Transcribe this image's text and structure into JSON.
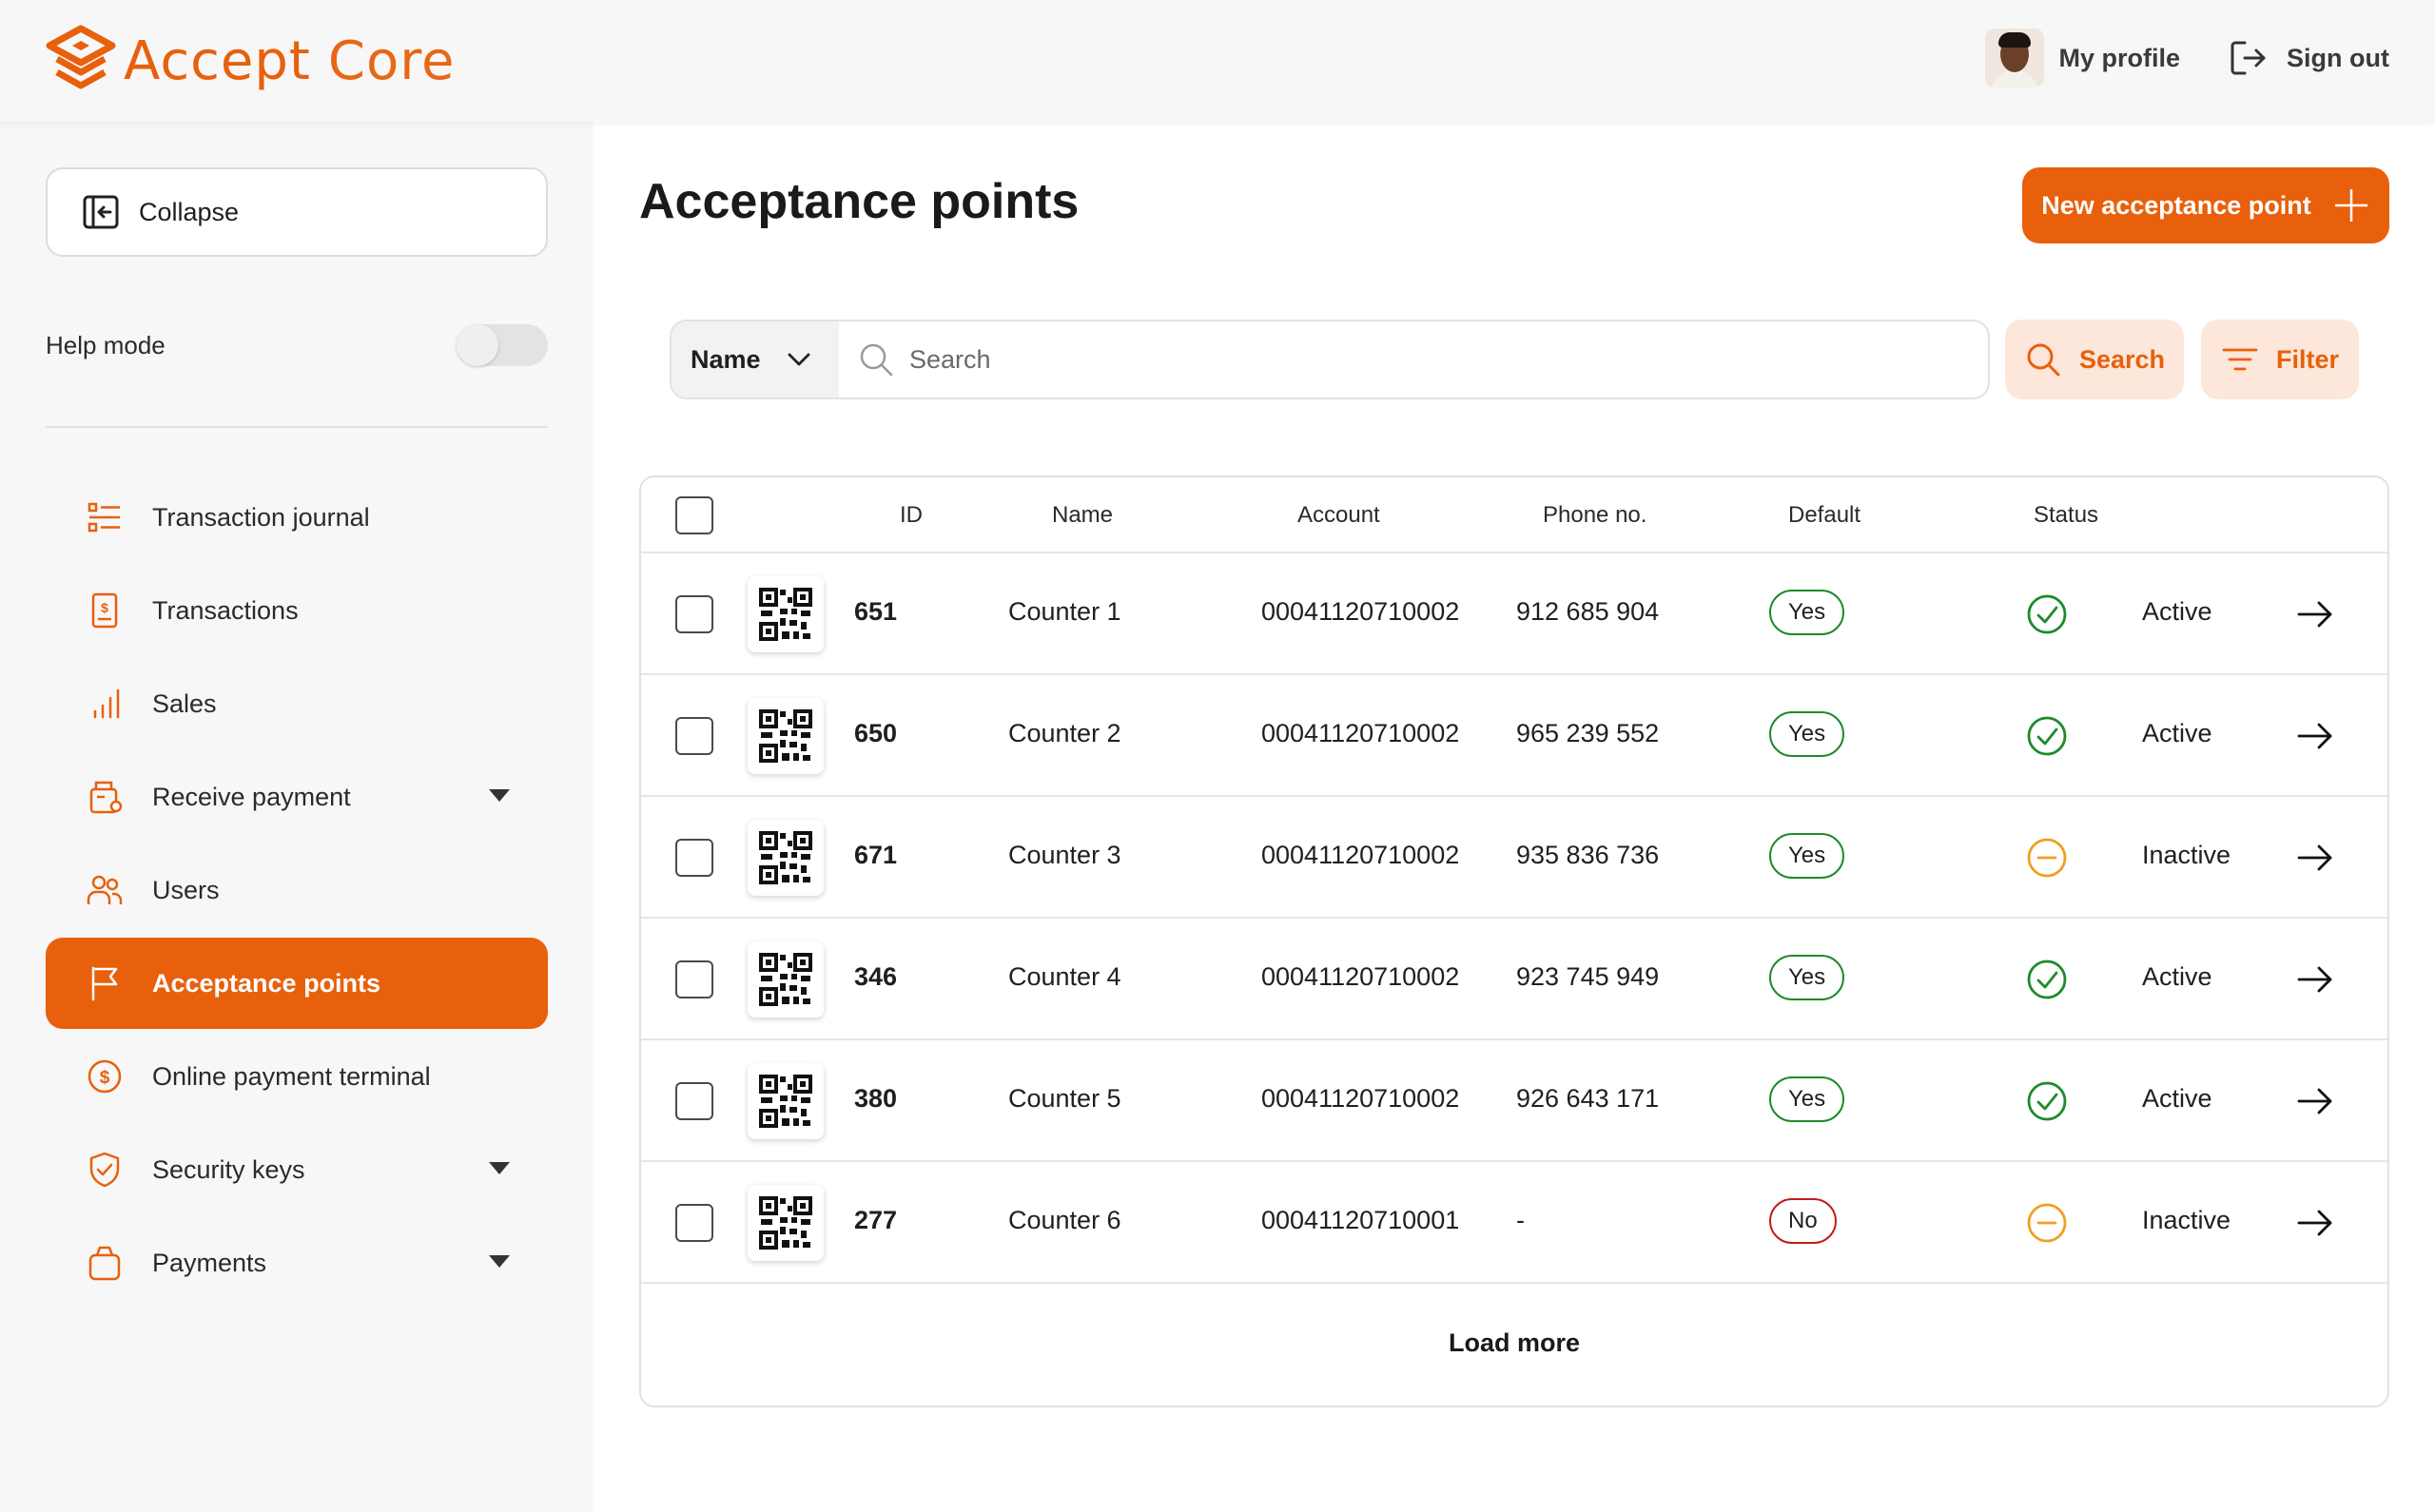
{
  "app": {
    "logo_brand": "Accept",
    "logo_product": "Core",
    "accent": "#e8600c"
  },
  "topbar": {
    "profile_label": "My profile",
    "signout_label": "Sign out"
  },
  "sidebar": {
    "collapse_label": "Collapse",
    "help_mode_label": "Help mode",
    "help_mode_on": false,
    "items": [
      {
        "label": "Transaction journal",
        "icon": "list-icon",
        "active": false,
        "has_submenu": false
      },
      {
        "label": "Transactions",
        "icon": "receipt-icon",
        "active": false,
        "has_submenu": false
      },
      {
        "label": "Sales",
        "icon": "bar-chart-icon",
        "active": false,
        "has_submenu": false
      },
      {
        "label": "Receive payment",
        "icon": "pos-terminal-icon",
        "active": false,
        "has_submenu": true
      },
      {
        "label": "Users",
        "icon": "users-icon",
        "active": false,
        "has_submenu": false
      },
      {
        "label": "Acceptance points",
        "icon": "flag-icon",
        "active": true,
        "has_submenu": false
      },
      {
        "label": "Online payment terminal",
        "icon": "dollar-circle-icon",
        "active": false,
        "has_submenu": false
      },
      {
        "label": "Security keys",
        "icon": "shield-icon",
        "active": false,
        "has_submenu": true
      },
      {
        "label": "Payments",
        "icon": "bag-icon",
        "active": false,
        "has_submenu": true
      }
    ]
  },
  "main": {
    "title": "Acceptance points",
    "new_button_label": "New acceptance point",
    "search": {
      "field_select": "Name",
      "placeholder": "Search",
      "value": "",
      "search_button_label": "Search",
      "filter_button_label": "Filter"
    },
    "table": {
      "columns": [
        "ID",
        "Name",
        "Account",
        "Phone no.",
        "Default",
        "Status"
      ],
      "rows": [
        {
          "id": "651",
          "name": "Counter 1",
          "account": "00041120710002",
          "phone": "912 685 904",
          "default": "Yes",
          "status": "Active"
        },
        {
          "id": "650",
          "name": "Counter 2",
          "account": "00041120710002",
          "phone": "965 239 552",
          "default": "Yes",
          "status": "Active"
        },
        {
          "id": "671",
          "name": "Counter 3",
          "account": "00041120710002",
          "phone": "935 836 736",
          "default": "Yes",
          "status": "Inactive"
        },
        {
          "id": "346",
          "name": "Counter 4",
          "account": "00041120710002",
          "phone": "923 745 949",
          "default": "Yes",
          "status": "Active"
        },
        {
          "id": "380",
          "name": "Counter 5",
          "account": "00041120710002",
          "phone": "926 643 171",
          "default": "Yes",
          "status": "Active"
        },
        {
          "id": "277",
          "name": "Counter 6",
          "account": "00041120710001",
          "phone": "-",
          "default": "No",
          "status": "Inactive"
        }
      ],
      "load_more_label": "Load more"
    }
  },
  "colors": {
    "active_status": "#1e8a2a",
    "inactive_status": "#f0a020",
    "default_yes": "#1e8a2a",
    "default_no": "#c01d1d"
  }
}
